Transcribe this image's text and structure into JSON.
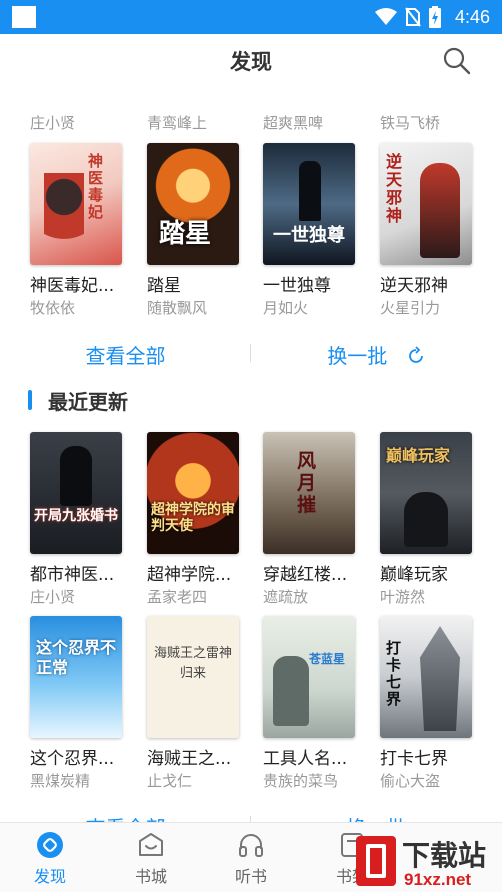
{
  "status_bar": {
    "time": "4:46"
  },
  "header": {
    "title": "发现"
  },
  "previous_authors": [
    "庄小贤",
    "青鸾峰上",
    "超爽黑啤",
    "铁马飞桥"
  ],
  "discover_books": [
    {
      "title": "神医毒妃...",
      "author": "牧依依",
      "cover_text": "神医毒妃"
    },
    {
      "title": "踏星",
      "author": "随散飘风",
      "cover_text": "踏星"
    },
    {
      "title": "一世独尊",
      "author": "月如火",
      "cover_text": "一世独尊"
    },
    {
      "title": "逆天邪神",
      "author": "火星引力",
      "cover_text": "逆天邪神"
    }
  ],
  "actions": {
    "view_all": "查看全部",
    "refresh": "换一批"
  },
  "recent": {
    "title": "最近更新",
    "books": [
      {
        "title": "都市神医...",
        "author": "庄小贤",
        "cover_text": "开局九张婚书"
      },
      {
        "title": "超神学院...",
        "author": "孟家老四",
        "cover_text": "超神学院的审判天使"
      },
      {
        "title": "穿越红楼...",
        "author": "遮疏放",
        "cover_text": "风月摧"
      },
      {
        "title": "巅峰玩家",
        "author": "叶游然",
        "cover_text": "巅峰玩家"
      },
      {
        "title": "这个忍界...",
        "author": "黑煤炭精",
        "cover_text": "这个忍界不正常"
      },
      {
        "title": "海贼王之...",
        "author": "止戈仁",
        "cover_text": "海贼王之雷神归来"
      },
      {
        "title": "工具人名...",
        "author": "贵族的菜鸟",
        "cover_text": "苍蓝星"
      },
      {
        "title": "打卡七界",
        "author": "偷心大盗",
        "cover_text": "打卡七界"
      }
    ]
  },
  "bottom_nav": [
    {
      "label": "发现",
      "icon": "discover-icon",
      "active": true
    },
    {
      "label": "书城",
      "icon": "bookstore-icon",
      "active": false
    },
    {
      "label": "听书",
      "icon": "headphones-icon",
      "active": false
    },
    {
      "label": "书架",
      "icon": "bookshelf-icon",
      "active": false
    }
  ],
  "watermark": {
    "text": "下载站",
    "sub": "91xz.net"
  },
  "colors": {
    "accent": "#1a8ff2",
    "muted": "#999999"
  }
}
